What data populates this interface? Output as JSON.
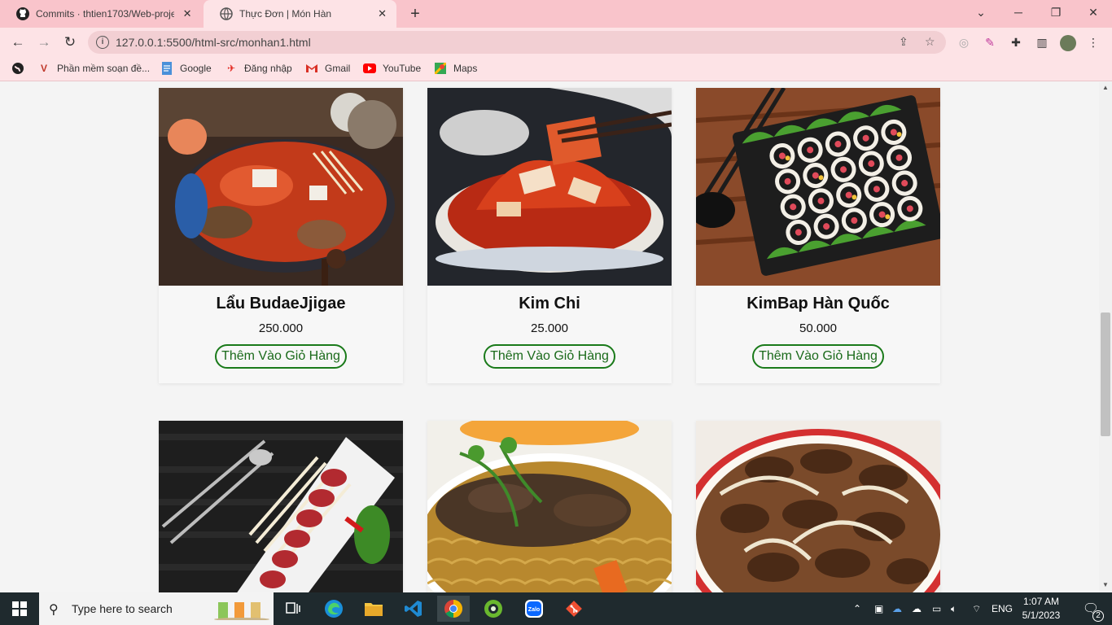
{
  "browser": {
    "tabs": [
      {
        "title": "Commits · thtien1703/Web-proje",
        "close": "✕"
      },
      {
        "title": "Thực Đơn | Món Hàn",
        "close": "✕"
      }
    ],
    "new_tab": "+",
    "url": "127.0.0.1:5500/html-src/monhan1.html",
    "bookmarks": [
      {
        "label": "Phần mềm soạn đề...",
        "icon": "v-icon",
        "color": "#c0392b"
      },
      {
        "label": "Google",
        "icon": "google-doc-icon",
        "color": "#4a90d9"
      },
      {
        "label": "Đăng nhập",
        "icon": "login-icon",
        "color": "#e2231a"
      },
      {
        "label": "Gmail",
        "icon": "gmail-icon",
        "color": "#d93025"
      },
      {
        "label": "YouTube",
        "icon": "youtube-icon",
        "color": "#ff0000"
      },
      {
        "label": "Maps",
        "icon": "maps-icon",
        "color": "#34a853"
      }
    ]
  },
  "menu": {
    "button_label": "Thêm Vào Giỏ Hàng",
    "items": [
      {
        "name": "Lẩu BudaeJjigae",
        "price": "250.000"
      },
      {
        "name": "Kim Chi",
        "price": "25.000"
      },
      {
        "name": "KimBap Hàn Quốc",
        "price": "50.000"
      },
      {
        "name": "",
        "price": ""
      },
      {
        "name": "",
        "price": ""
      },
      {
        "name": "",
        "price": ""
      }
    ]
  },
  "taskbar": {
    "search_placeholder": "Type here to search",
    "language": "ENG",
    "time": "1:07 AM",
    "date": "5/1/2023",
    "notification_count": "2"
  },
  "colors": {
    "tab_bar": "#f9c4cb",
    "toolbar": "#fde3e6",
    "button_border": "#1a7a1a",
    "taskbar": "#1f2a2e"
  }
}
